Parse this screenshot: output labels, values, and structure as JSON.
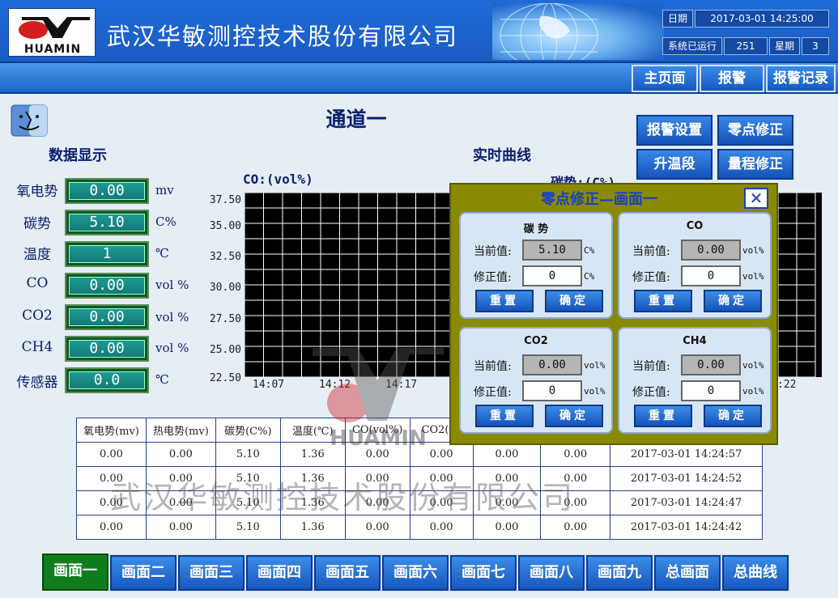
{
  "header": {
    "company": "武汉华敏测控技术股份有限公司",
    "logo_text": "HUAMIN",
    "date_label": "日期",
    "datetime": "2017-03-01 14:25:00",
    "runtime_label": "系统已运行",
    "runtime_value": "251",
    "weekday_label": "星期",
    "weekday_value": "3"
  },
  "nav": {
    "home": "主页面",
    "alarm": "报警",
    "alarm_record": "报警记录"
  },
  "page_title": "通道一",
  "sections": {
    "data_display": "数据显示",
    "realtime_curve": "实时曲线"
  },
  "actions": {
    "alarm_settings": "报警设置",
    "zero_correction": "零点修正",
    "heat_stage": "升温段",
    "range_correction": "量程修正"
  },
  "params": [
    {
      "label": "氧电势",
      "value": "0.00",
      "unit": "mv"
    },
    {
      "label": "碳势",
      "value": "5.10",
      "unit": "C%"
    },
    {
      "label": "温度",
      "value": "1",
      "unit": "℃"
    },
    {
      "label": "CO",
      "value": "0.00",
      "unit": "vol %"
    },
    {
      "label": "CO2",
      "value": "0.00",
      "unit": "vol %"
    },
    {
      "label": "CH4",
      "value": "0.00",
      "unit": "vol %"
    },
    {
      "label": "传感器",
      "value": "0.0",
      "unit": "℃"
    }
  ],
  "chart_data": [
    {
      "type": "line",
      "title": "CO:(vol%)",
      "ylim": [
        22.5,
        37.5
      ],
      "y_ticks": [
        "37.50",
        "35.00",
        "32.50",
        "30.00",
        "27.50",
        "25.00",
        "22.50"
      ],
      "x_ticks": [
        "14:07",
        "14:12",
        "14:17"
      ],
      "series": [],
      "grid": true
    },
    {
      "type": "line",
      "title": "碳势:(C%)",
      "x_ticks": [
        ":22"
      ],
      "series": [],
      "grid": true
    }
  ],
  "table": {
    "headers": [
      "氧电势(mv)",
      "热电势(mv)",
      "碳势(C%)",
      "温度(℃)",
      "CO(vol%)",
      "CO2(vo",
      "",
      "",
      ""
    ],
    "rows": [
      [
        "0.00",
        "0.00",
        "5.10",
        "1.36",
        "0.00",
        "0.00",
        "0.00",
        "0.00",
        "2017-03-01  14:24:57"
      ],
      [
        "0.00",
        "0.00",
        "5.10",
        "1.36",
        "0.00",
        "0.00",
        "0.00",
        "0.00",
        "2017-03-01  14:24:52"
      ],
      [
        "0.00",
        "0.00",
        "5.10",
        "1.36",
        "0.00",
        "0.00",
        "0.00",
        "0.00",
        "2017-03-01  14:24:47"
      ],
      [
        "0.00",
        "0.00",
        "5.10",
        "1.36",
        "0.00",
        "0.00",
        "0.00",
        "0.00",
        "2017-03-01  14:24:42"
      ]
    ]
  },
  "watermark": {
    "logo_text": "HUAMIN",
    "text": "武汉华敏测控技术股份有限公司"
  },
  "dialog": {
    "title": "零点修正—画面一",
    "close": "✕",
    "current_label": "当前值:",
    "correct_label": "修正值:",
    "reset_label": "重置",
    "confirm_label": "确定",
    "panels": [
      {
        "title": "碳  势",
        "current": "5.10",
        "correct": "0",
        "unit": "C%"
      },
      {
        "title": "CO",
        "current": "0.00",
        "correct": "0",
        "unit": "vol%"
      },
      {
        "title": "CO2",
        "current": "0.00",
        "correct": "0",
        "unit": "vol%"
      },
      {
        "title": "CH4",
        "current": "0.00",
        "correct": "0",
        "unit": "vol%"
      }
    ]
  },
  "tabs": [
    "画面一",
    "画面二",
    "画面三",
    "画面四",
    "画面五",
    "画面六",
    "画面七",
    "画面八",
    "画面九",
    "总画面",
    "总曲线"
  ],
  "active_tab": 0,
  "colors": {
    "header_blue": "#1e6bd8",
    "button_blue": "#1553bb",
    "active_green": "#0f7d1c",
    "value_teal": "#1d9a95",
    "dialog_olive": "#8a8a00"
  }
}
